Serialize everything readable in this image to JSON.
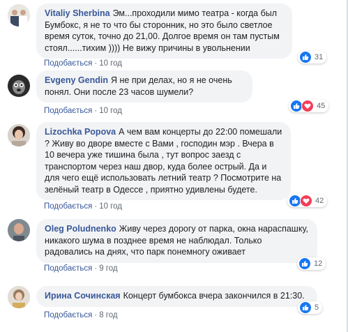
{
  "actions": {
    "like": "Подобається",
    "dot": "·"
  },
  "comments": [
    {
      "author": "Vitaliy Sherbina",
      "text": "Эм...проходили мимо театра - когда был Бумбокс, я не то что бы сторонник, но это было светлое время суток, точно до 21,00. Долгое время он там пустым стоял......тихим )))) Не вижу причины в увольнении",
      "time": "10 год",
      "reactions": "31"
    },
    {
      "author": "Evgeny Gendin",
      "text": "Я не при делах, но я не очень понял. Они после 23 часов шумели?",
      "time": "10 год",
      "reactions": "45"
    },
    {
      "author": "Lizochka Popova",
      "text": "А чем вам концерты до 22:00 помешали ? Живу во дворе вместе с Вами , господин мэр . Вчера в 10 вечера уже тишина была , тут вопрос заезд с транспортом через наш двор, куда более острый. Да и для чего ещё использовать летний театр ? Посмотрите на зелёный театр в Одессе , приятно удивлены будете.",
      "time": "10 год",
      "reactions": "42"
    },
    {
      "author": "Oleg Poludnenko",
      "text": "Живу через дорогу от парка, окна нараспашку, никакого шума в позднее время не наблюдал. Только радовались на днях, что парк понемногу оживает",
      "time": "9 год",
      "reactions": "12"
    },
    {
      "author": "Ирина Сочинская",
      "text": "Концерт бумбокса вчера закончился в 21:30.",
      "time": "8 год",
      "reactions": "5"
    }
  ]
}
